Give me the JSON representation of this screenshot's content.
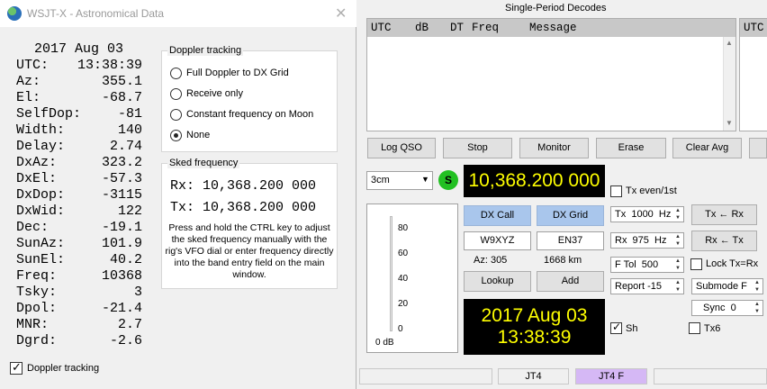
{
  "astro": {
    "title": "WSJT-X - Astronomical Data",
    "close_icon": "close-icon",
    "date": "2017 Aug 03",
    "rows": [
      {
        "label": "UTC:",
        "value": "13:38:39"
      },
      {
        "label": "Az:",
        "value": "355.1"
      },
      {
        "label": "El:",
        "value": "-68.7"
      },
      {
        "label": "SelfDop:",
        "value": "-81"
      },
      {
        "label": "Width:",
        "value": "140"
      },
      {
        "label": "Delay:",
        "value": "2.74"
      },
      {
        "label": "DxAz:",
        "value": "323.2"
      },
      {
        "label": "DxEl:",
        "value": "-57.3"
      },
      {
        "label": "DxDop:",
        "value": "-3115"
      },
      {
        "label": "DxWid:",
        "value": "122"
      },
      {
        "label": "Dec:",
        "value": "-19.1"
      },
      {
        "label": "SunAz:",
        "value": "101.9"
      },
      {
        "label": "SunEl:",
        "value": "40.2"
      },
      {
        "label": "Freq:",
        "value": "10368"
      },
      {
        "label": "Tsky:",
        "value": "3"
      },
      {
        "label": "Dpol:",
        "value": "-21.4"
      },
      {
        "label": "MNR:",
        "value": "2.7"
      },
      {
        "label": "Dgrd:",
        "value": "-2.6"
      }
    ],
    "doppler_tracking": {
      "title": "Doppler tracking",
      "options": [
        "Full Doppler to DX Grid",
        "Receive only",
        "Constant frequency on Moon",
        "None"
      ],
      "selected": "None"
    },
    "sked": {
      "title": "Sked frequency",
      "rx_label": "Rx:",
      "rx_value": "10,368.200 000",
      "tx_label": "Tx:",
      "tx_value": "10,368.200 000",
      "note": "Press and hold the CTRL key to adjust the sked frequency manually with the rig's VFO dial or enter frequency directly into the band entry field on the main window."
    },
    "doppler_checkbox": "Doppler tracking"
  },
  "main": {
    "decodes_title": "Single-Period Decodes",
    "decode_columns": [
      "UTC",
      "dB",
      "DT",
      "Freq",
      "Message"
    ],
    "right_column": "UTC",
    "buttons": [
      "Log QSO",
      "Stop",
      "Monitor",
      "Erase",
      "Clear Avg"
    ],
    "band": "3cm",
    "s_label": "S",
    "frequency": "10,368.200 000",
    "meter_ticks": [
      "80",
      "60",
      "40",
      "20",
      "0"
    ],
    "meter_label": "0 dB",
    "dx_call_label": "DX Call",
    "dx_grid_label": "DX Grid",
    "dx_call": "W9XYZ",
    "dx_grid": "EN37",
    "az": "Az: 305",
    "distance": "1668 km",
    "lookup": "Lookup",
    "add": "Add",
    "clock_date": "2017 Aug 03",
    "clock_time": "13:38:39",
    "tx_even": "Tx even/1st",
    "tx_freq": "Tx  1000  Hz",
    "rx_freq": "Rx  975  Hz",
    "ftol": "F Tol  500",
    "report": "Report -15",
    "tx_from_rx": "Tx ← Rx",
    "rx_from_tx": "Rx ← Tx",
    "lock": "Lock Tx=Rx",
    "submode": "Submode F",
    "sync": "Sync  0",
    "sh": "Sh",
    "tx6": "Tx6",
    "status_mode1": "JT4",
    "status_mode2": "JT4 F"
  }
}
